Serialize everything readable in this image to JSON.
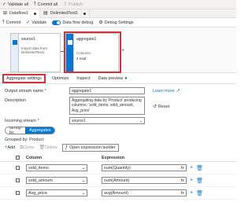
{
  "topbar": {
    "validate_all": "Validate all",
    "commit_all": "Commit all",
    "publish": "Publish"
  },
  "tabs": [
    {
      "label": "Dataflow1",
      "active": true
    },
    {
      "label": "DelimitedText1",
      "active": false
    }
  ],
  "toolbar2": {
    "commit": "Commit",
    "validate": "Validate",
    "debug": "Data flow debug",
    "debug_settings": "Debug Settings"
  },
  "canvas": {
    "source": {
      "title": "source1",
      "sub": "Import data from DelimitedText1"
    },
    "aggregate": {
      "title": "aggregate1",
      "columns_label": "Columns:",
      "columns_value": "4 total"
    },
    "add_icon": "+"
  },
  "settings_tabs": [
    "Aggregate settings",
    "Optimize",
    "Inspect",
    "Data preview"
  ],
  "form": {
    "stream_label": "Output stream name",
    "stream_value": "aggregate1",
    "learn_more": "Learn more",
    "description_label": "Description",
    "description_value": "Aggregating data by 'Product' producing columns: 'sold_items, sold_amount, Avg_price'",
    "reset": "Reset",
    "incoming_label": "Incoming stream",
    "incoming_value": "source1"
  },
  "segment": {
    "group_by": "Group by",
    "aggregates": "Aggregates"
  },
  "grouped_by": "Grouped by: Product",
  "actions": {
    "add": "Add",
    "clone": "Clone",
    "delete": "Delete",
    "expression_builder": "Open expression builder"
  },
  "table": {
    "headers": {
      "column": "Column",
      "expression": "Expression"
    },
    "rows": [
      {
        "column": "sold_items",
        "expression": "sum(Quantity)"
      },
      {
        "column": "sold_amount",
        "expression": "sum(Amount)"
      },
      {
        "column": "Avg_price",
        "expression": "avg(Amount)"
      }
    ]
  },
  "icons": {
    "fx": "fx"
  },
  "colors": {
    "accent": "#0078d4",
    "highlight": "#d13438"
  }
}
